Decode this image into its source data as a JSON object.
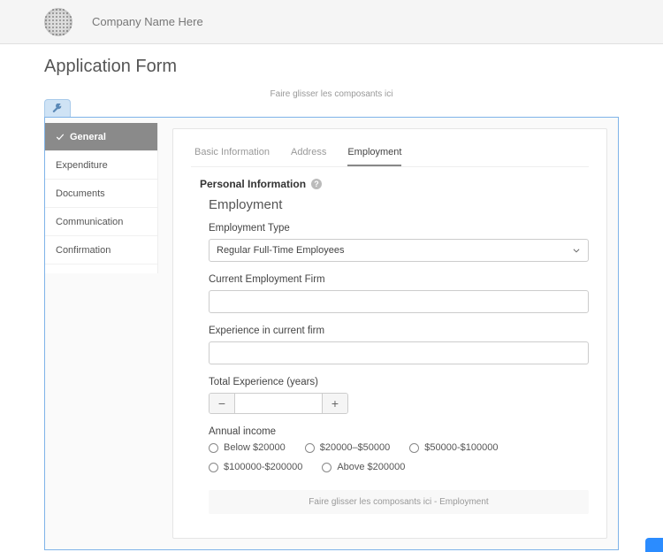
{
  "header": {
    "company_name": "Company Name Here"
  },
  "page_title": "Application Form",
  "dropzone_top_label": "Faire glisser les composants ici",
  "sidebar": {
    "items": [
      {
        "label": "General",
        "active": true
      },
      {
        "label": "Expenditure"
      },
      {
        "label": "Documents"
      },
      {
        "label": "Communication"
      },
      {
        "label": "Confirmation"
      }
    ]
  },
  "inner_tabs": [
    {
      "label": "Basic Information"
    },
    {
      "label": "Address"
    },
    {
      "label": "Employment",
      "active": true
    }
  ],
  "section": {
    "personal_info_label": "Personal Information",
    "subsection_title": "Employment"
  },
  "fields": {
    "employment_type": {
      "label": "Employment Type",
      "value": "Regular Full-Time Employees"
    },
    "current_firm": {
      "label": "Current Employment Firm",
      "value": ""
    },
    "experience_current": {
      "label": "Experience in current firm",
      "value": ""
    },
    "total_experience": {
      "label": "Total Experience (years)",
      "value": ""
    },
    "annual_income": {
      "label": "Annual income",
      "options": [
        "Below $20000",
        "$20000–$50000",
        "$50000-$100000",
        "$100000-$200000",
        "Above $200000"
      ]
    }
  },
  "dropzone_employment_label": "Faire glisser les composants ici - Employment"
}
